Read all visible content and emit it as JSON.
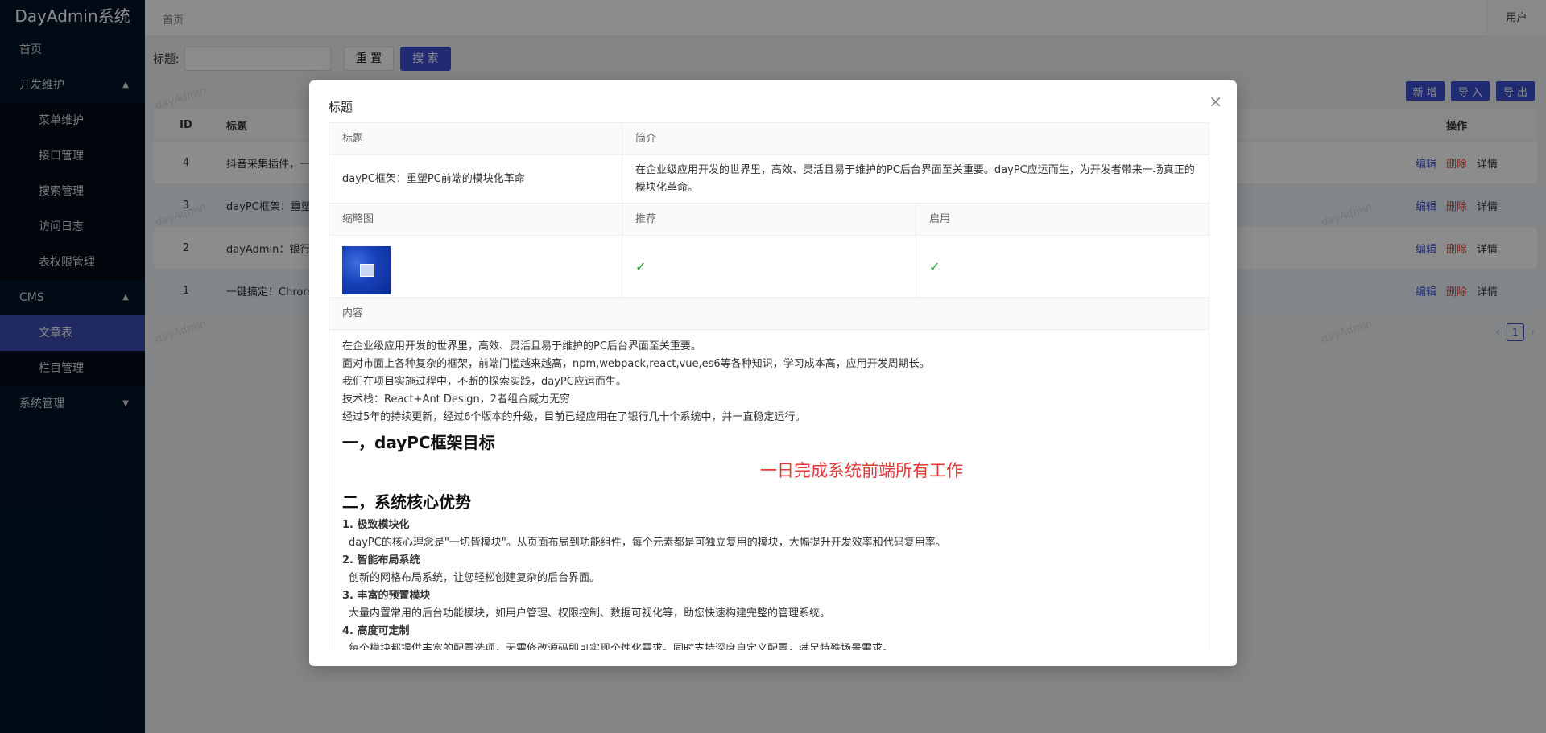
{
  "app": {
    "title": "DayAdmin系统"
  },
  "sidebar": {
    "items": [
      {
        "label": "首页",
        "type": "top"
      },
      {
        "label": "开发维护",
        "type": "group",
        "chevron": "up"
      },
      {
        "label": "菜单维护",
        "type": "sub"
      },
      {
        "label": "接口管理",
        "type": "sub"
      },
      {
        "label": "搜索管理",
        "type": "sub"
      },
      {
        "label": "访问日志",
        "type": "sub"
      },
      {
        "label": "表权限管理",
        "type": "sub"
      },
      {
        "label": "CMS",
        "type": "group",
        "chevron": "up"
      },
      {
        "label": "文章表",
        "type": "sub",
        "active": true
      },
      {
        "label": "栏目管理",
        "type": "sub"
      },
      {
        "label": "系统管理",
        "type": "group",
        "chevron": "down"
      }
    ]
  },
  "header": {
    "breadcrumb": "首页",
    "user": "用户"
  },
  "search": {
    "label": "标题:",
    "placeholder": "",
    "reset": "重 置",
    "submit": "搜 索"
  },
  "toolbar": {
    "add": "新 增",
    "import": "导 入",
    "export": "导 出"
  },
  "table": {
    "headers": {
      "id": "ID",
      "title": "标题",
      "ops": "操作"
    },
    "rows": [
      {
        "id": "4",
        "title": "抖音采集插件，一",
        "edit": "编辑",
        "delete": "删除",
        "detail": "详情"
      },
      {
        "id": "3",
        "title": "dayPC框架：重塑",
        "edit": "编辑",
        "delete": "删除",
        "detail": "详情"
      },
      {
        "id": "2",
        "title": "dayAdmin：银行",
        "edit": "编辑",
        "delete": "删除",
        "detail": "详情"
      },
      {
        "id": "1",
        "title": "一键搞定！Chrom",
        "edit": "编辑",
        "delete": "删除",
        "detail": "详情"
      }
    ]
  },
  "pagination": {
    "current": "1"
  },
  "watermark": "dayAdmin",
  "modal": {
    "title": "标题",
    "close": "×",
    "labels": {
      "title": "标题",
      "summary": "简介",
      "thumbnail": "缩略图",
      "recommend": "推荐",
      "enabled": "启用",
      "content": "内容"
    },
    "values": {
      "title": "dayPC框架：重塑PC前端的模块化革命",
      "summary": "在企业级应用开发的世界里，高效、灵活且易于维护的PC后台界面至关重要。dayPC应运而生，为开发者带来一场真正的模块化革命。",
      "recommend": "✓",
      "enabled": "✓"
    },
    "content": {
      "paragraphs": [
        "在企业级应用开发的世界里，高效、灵活且易于维护的PC后台界面至关重要。",
        "面对市面上各种复杂的框架，前端门槛越来越高，npm,webpack,react,vue,es6等各种知识，学习成本高，应用开发周期长。",
        "我们在项目实施过程中，不断的探索实践，dayPC应运而生。",
        "技术栈：React+Ant Design，2者组合威力无穷",
        "经过5年的持续更新，经过6个版本的升级，目前已经应用在了银行几十个系统中，并一直稳定运行。"
      ],
      "heading1": "一，dayPC框架目标",
      "slogan": "一日完成系统前端所有工作",
      "heading2": "二，系统核心优势",
      "features": [
        {
          "title": "1. 极致模块化",
          "text": "dayPC的核心理念是\"一切皆模块\"。从页面布局到功能组件，每个元素都是可独立复用的模块，大幅提升开发效率和代码复用率。"
        },
        {
          "title": "2. 智能布局系统",
          "text": "创新的网格布局系统，让您轻松创建复杂的后台界面。"
        },
        {
          "title": "3. 丰富的预置模块",
          "text": "大量内置常用的后台功能模块，如用户管理、权限控制、数据可视化等，助您快速构建完整的管理系统。"
        },
        {
          "title": "4. 高度可定制",
          "text": "每个模块都提供丰富的配置选项，无需修改源码即可实现个性化需求。同时支持深度自定义配置，满足特殊场景需求。"
        }
      ]
    }
  }
}
